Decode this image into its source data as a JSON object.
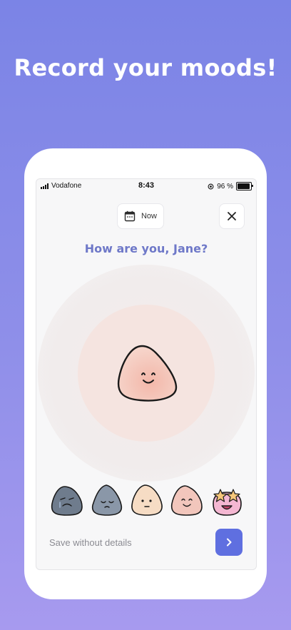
{
  "headline": "Record your moods!",
  "status_bar": {
    "carrier": "Vodafone",
    "time": "8:43",
    "battery": "96 %"
  },
  "top_bar": {
    "date_label": "Now",
    "date_icon": "calendar-icon",
    "close_icon": "close-icon"
  },
  "question": "How are you, Jane?",
  "selected_mood": "happy",
  "moods": [
    {
      "name": "awful",
      "color": "#6f7c8d"
    },
    {
      "name": "sad",
      "color": "#8a97a8"
    },
    {
      "name": "neutral",
      "color": "#f6dcc4"
    },
    {
      "name": "happy",
      "color": "#f2c6bc"
    },
    {
      "name": "amazing",
      "color": "#f4b7d2"
    }
  ],
  "footer": {
    "save_label": "Save without details",
    "next_icon": "chevron-right-icon",
    "accent": "#5f6fe0"
  }
}
